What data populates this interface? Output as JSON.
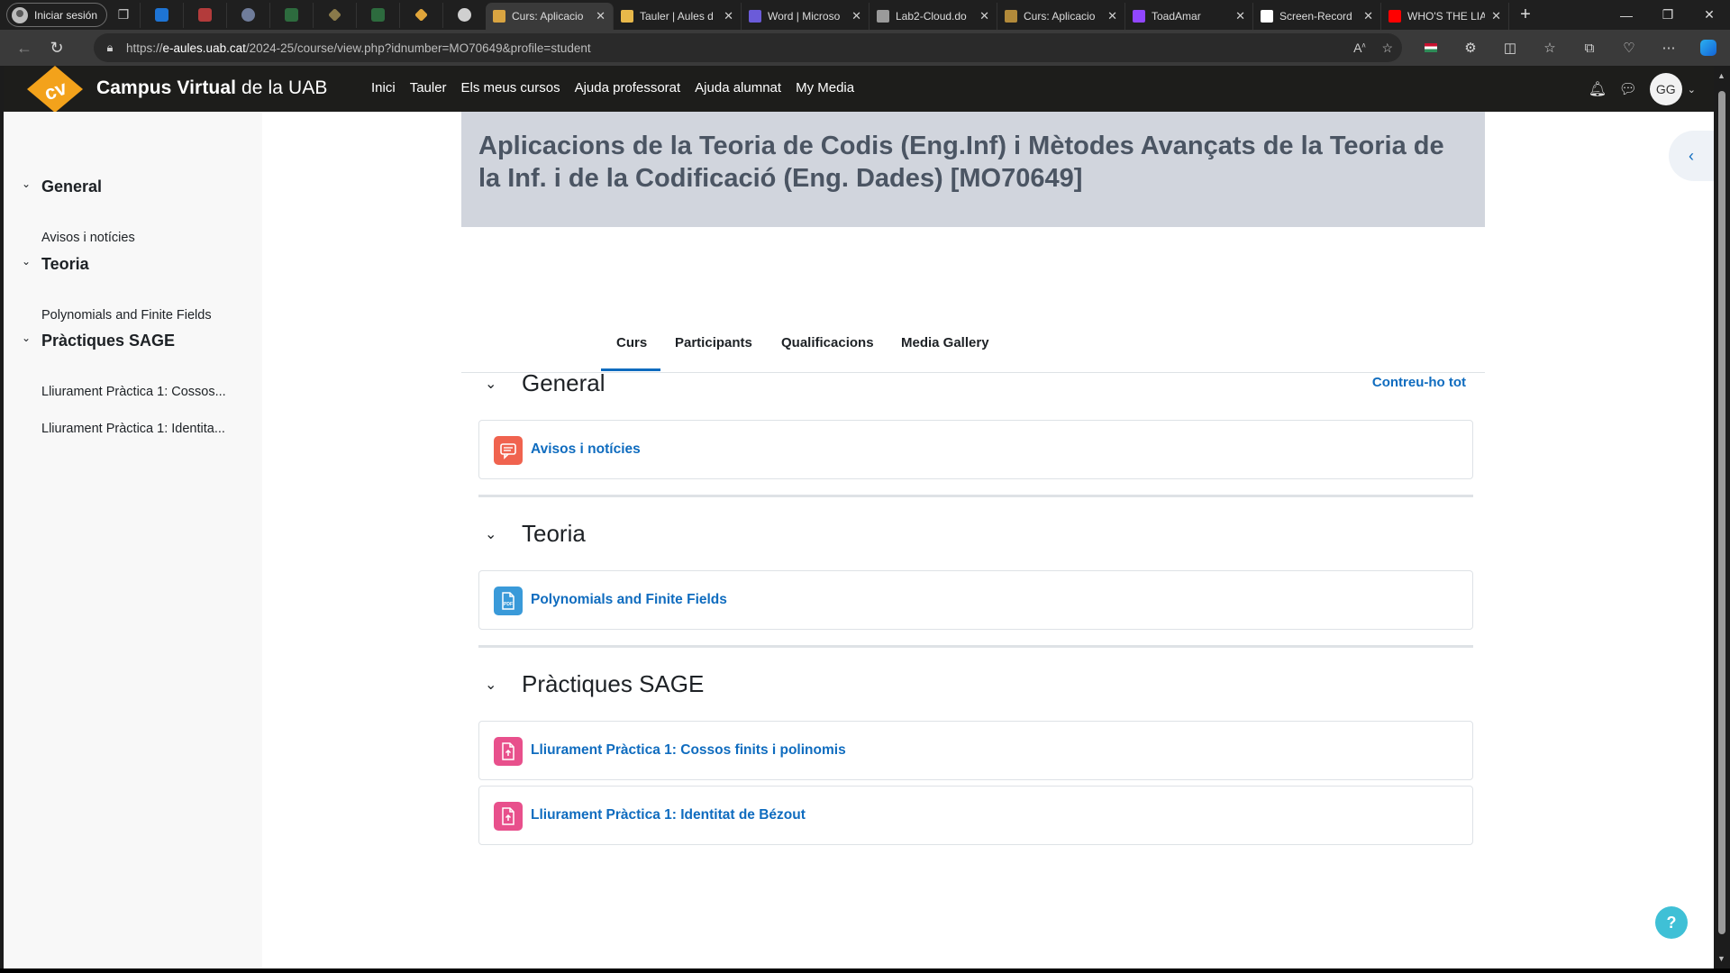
{
  "browser": {
    "profile_label": "Iniciar sesión",
    "tabs": [
      {
        "title": "Curs: Aplicacio",
        "fav": "#d9a441",
        "active": true
      },
      {
        "title": "Tauler | Aules d",
        "fav": "#e8b84a",
        "active": false
      },
      {
        "title": "Word | Microso",
        "fav": "#6b5bd9",
        "active": false
      },
      {
        "title": "Lab2-Cloud.do",
        "fav": "#9a9a9a",
        "active": false
      },
      {
        "title": "Curs: Aplicacio",
        "fav": "#b28a3a",
        "active": false
      },
      {
        "title": "ToadAmar",
        "fav": "#9146ff",
        "active": false
      },
      {
        "title": "Screen-Record",
        "fav": "#ffffff",
        "active": false
      },
      {
        "title": "WHO'S THE LIA",
        "fav": "#ff0000",
        "active": false
      }
    ],
    "url_prefix": "https://",
    "url_host": "e-aules.uab.cat",
    "url_path": "/2024-25/course/view.php?idnumber=MO70649&profile=student"
  },
  "site": {
    "brand_bold": "Campus Virtual",
    "brand_thin": " de la UAB",
    "nav": [
      "Inici",
      "Tauler",
      "Els meus cursos",
      "Ajuda professorat",
      "Ajuda alumnat",
      "My Media"
    ],
    "user_initials": "GG"
  },
  "drawer": {
    "sections": [
      {
        "title": "General",
        "items": [
          "Avisos i notícies"
        ]
      },
      {
        "title": "Teoria",
        "items": [
          "Polynomials and Finite Fields"
        ]
      },
      {
        "title": "Pràctiques SAGE",
        "items": [
          "Lliurament Pràctica 1: Cossos...",
          "Lliurament Pràctica 1: Identita..."
        ]
      }
    ]
  },
  "course": {
    "title": "Aplicacions de la Teoria de Codis (Eng.Inf) i Mètodes Avançats de la Teoria de la Inf. i de la Codificació (Eng. Dades) [MO70649]",
    "tabs": [
      "Curs",
      "Participants",
      "Qualificacions",
      "Media Gallery"
    ],
    "active_tab": "Curs",
    "collapse_all": "Contreu-ho tot",
    "sections": [
      {
        "title": "General",
        "activities": [
          {
            "name": "Avisos i notícies",
            "icon": "forum-icon",
            "color": "#f0634f"
          }
        ]
      },
      {
        "title": "Teoria",
        "activities": [
          {
            "name": "Polynomials and Finite Fields",
            "icon": "pdf-file-icon",
            "color": "#3a9ad9"
          }
        ]
      },
      {
        "title": "Pràctiques SAGE",
        "activities": [
          {
            "name": "Lliurament Pràctica 1: Cossos finits i polinomis",
            "icon": "assignment-icon",
            "color": "#e8508c"
          },
          {
            "name": "Lliurament Pràctica 1: Identitat de Bézout",
            "icon": "assignment-icon",
            "color": "#e8508c"
          }
        ]
      }
    ]
  },
  "help_label": "?"
}
